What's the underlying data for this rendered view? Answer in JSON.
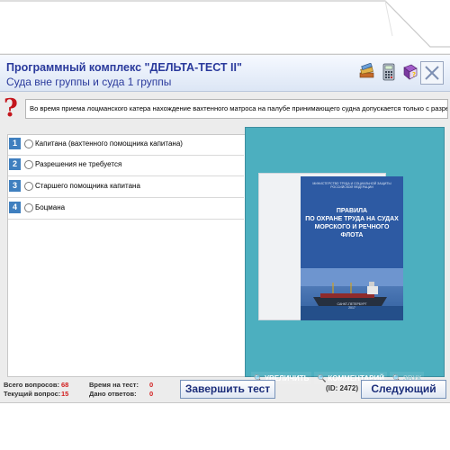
{
  "header": {
    "title": "Программный комплекс \"ДЕЛЬТА-ТЕСТ II\"",
    "subtitle": "Суда вне группы и суда 1 группы",
    "icons": [
      "book-stack-icon",
      "calculator-icon",
      "help-book-icon",
      "close-icon"
    ]
  },
  "question": {
    "icon": "question-mark-icon",
    "text": "Во время приема лоцманского катера нахождение вахтенного матроса на палубе принимающего судна допускается только с разрешения"
  },
  "answers": [
    {
      "num": "1",
      "label": "Капитана (вахтенного помощника капитана)"
    },
    {
      "num": "2",
      "label": "Разрешения не требуется"
    },
    {
      "num": "3",
      "label": "Старшего помощника капитана"
    },
    {
      "num": "4",
      "label": "Боцмана"
    }
  ],
  "image": {
    "cover_top": "МИНИСТЕРСТВО ТРУДА И СОЦИАЛЬНОЙ ЗАЩИТЫ РОССИЙСКОЙ ФЕДЕРАЦИИ",
    "title_lines": [
      "ПРАВИЛА",
      "ПО ОХРАНЕ ТРУДА НА СУДАХ",
      "МОРСКОГО И РЕЧНОГО ФЛОТА"
    ],
    "city": "САНКТ-ПЕТЕРБУРГ",
    "year": "2017"
  },
  "tools": {
    "zoom": "УВЕЛИЧИТЬ",
    "comment": "КОММЕНТАРИЙ",
    "sound": "ЗВУК"
  },
  "footer": {
    "total_label": "Всего вопросов:",
    "total_value": "68",
    "current_label": "Текущий вопрос:",
    "current_value": "15",
    "time_label": "Время на тест:",
    "time_value": "0",
    "answered_label": "Дано ответов:",
    "answered_value": "0",
    "finish_button": "Завершить тест",
    "id_text": "(ID: 2472)",
    "next_button": "Следующий"
  },
  "colors": {
    "accent": "#2a3a9c",
    "panel": "#4cafbf",
    "number_badge": "#3f7fbf",
    "alert_red": "#c4161c"
  }
}
